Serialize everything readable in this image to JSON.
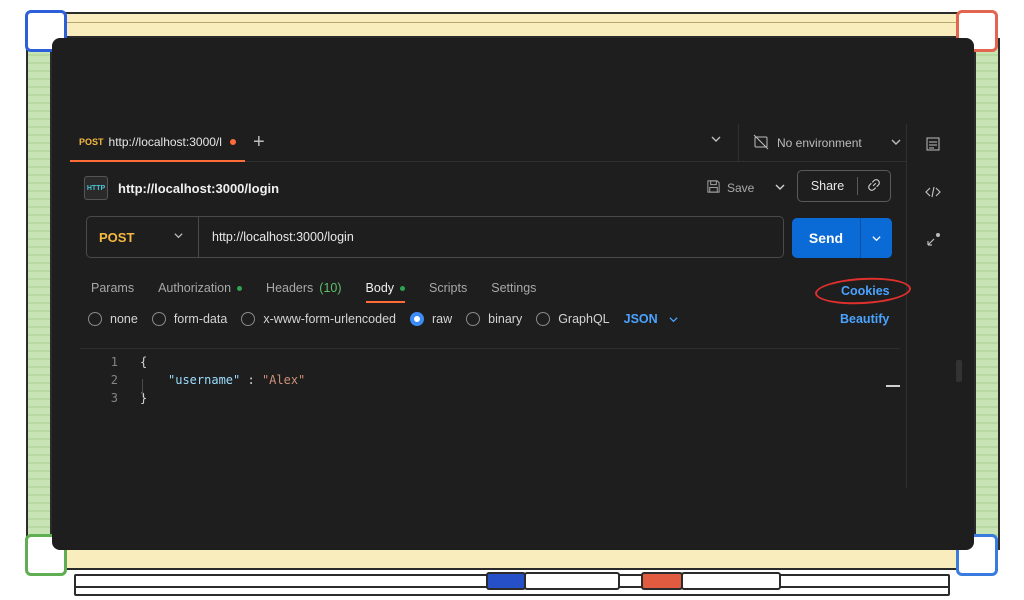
{
  "tab": {
    "method": "POST",
    "url": "http://localhost:3000/l"
  },
  "environment": {
    "label": "No environment"
  },
  "request": {
    "title": "http://localhost:3000/login",
    "http_icon": "HTTP",
    "save_label": "Save",
    "share_label": "Share",
    "method": "POST",
    "url": "http://localhost:3000/login",
    "send_label": "Send"
  },
  "request_tabs": {
    "params": "Params",
    "authorization": "Authorization",
    "headers": "Headers",
    "headers_count": "(10)",
    "body": "Body",
    "scripts": "Scripts",
    "settings": "Settings"
  },
  "cookies_label": "Cookies",
  "beautify_label": "Beautify",
  "body_types": {
    "none": "none",
    "form_data": "form-data",
    "urlencoded": "x-www-form-urlencoded",
    "raw": "raw",
    "binary": "binary",
    "graphql": "GraphQL",
    "selected": "raw",
    "language": "JSON"
  },
  "editor": {
    "line_numbers": [
      "1",
      "2",
      "3"
    ],
    "open_brace": "{",
    "key": "\"username\"",
    "separator": " : ",
    "value": "\"Alex\"",
    "close_brace": "}"
  },
  "colors": {
    "accent": "#ff6c37",
    "send": "#0a6bd6",
    "link": "#4aa3ff",
    "method": "#f5b942",
    "annotation": "#e0302d"
  }
}
